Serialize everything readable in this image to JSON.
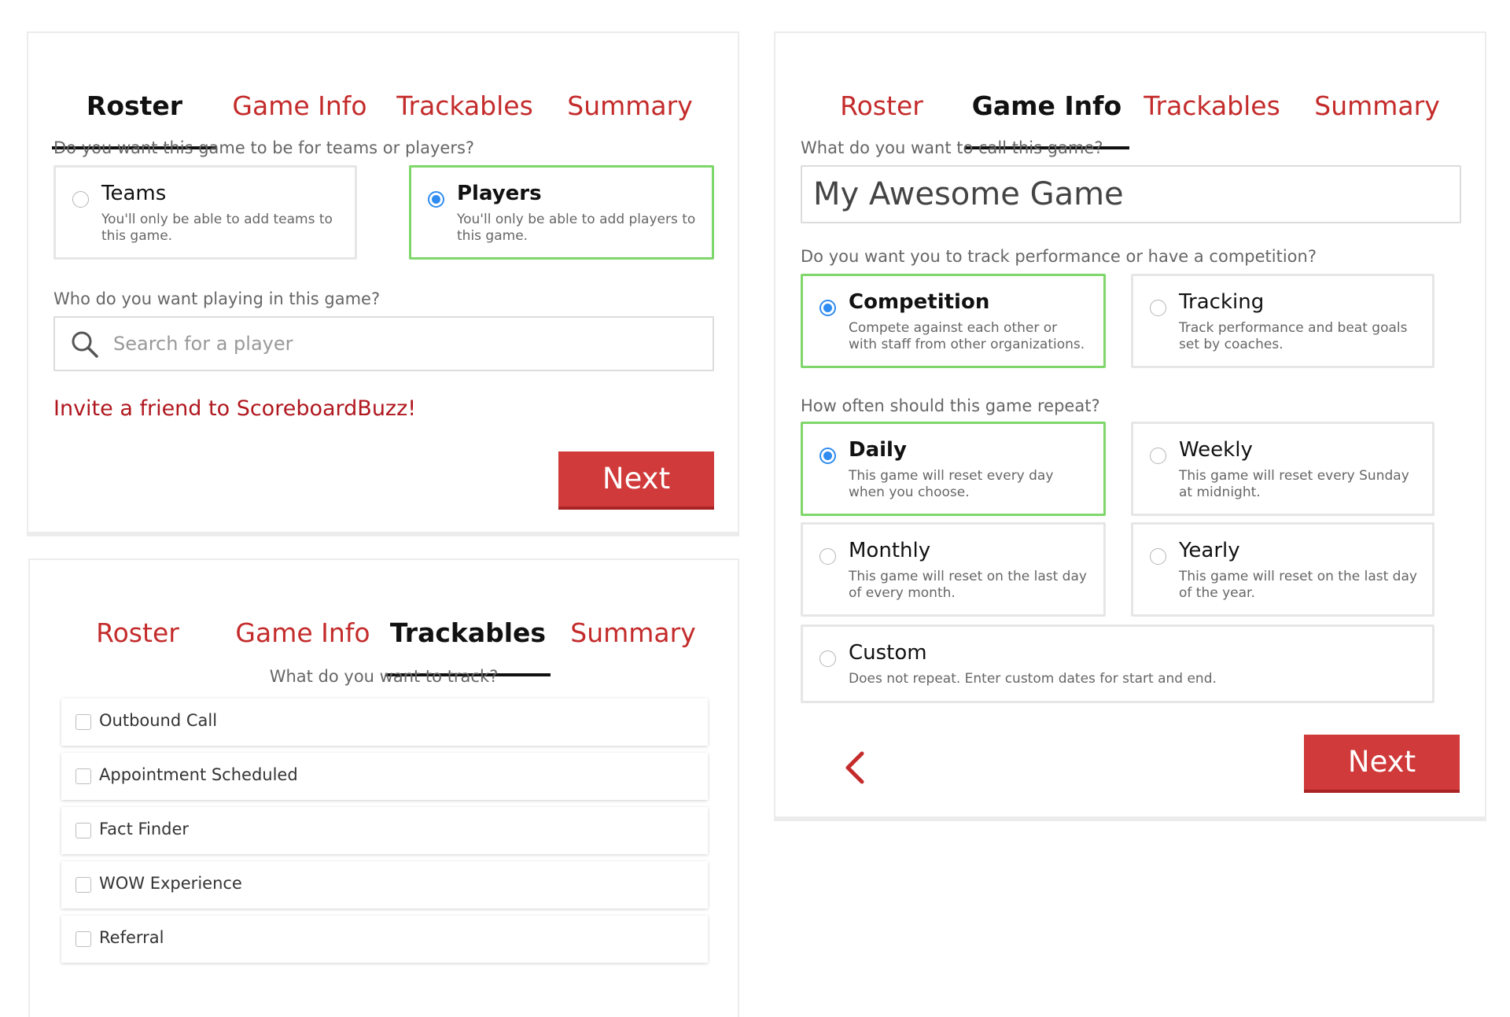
{
  "tabs": {
    "roster": "Roster",
    "game_info": "Game Info",
    "trackables": "Trackables",
    "summary": "Summary"
  },
  "roster": {
    "question_type": "Do you want this game to be for teams or players?",
    "options": [
      {
        "title": "Teams",
        "desc": "You'll only be able to add teams to this game.",
        "selected": false
      },
      {
        "title": "Players",
        "desc": "You'll only be able to add players to this game.",
        "selected": true
      }
    ],
    "question_players": "Who do you want playing in this game?",
    "search_placeholder": "Search for a player",
    "invite_link": "Invite a friend to ScoreboardBuzz!",
    "next_label": "Next"
  },
  "game_info": {
    "question_name": "What do you want to call this game?",
    "name_value": "My Awesome Game",
    "question_mode": "Do you want you to track performance or have a competition?",
    "mode_options": [
      {
        "title": "Competition",
        "desc": "Compete against each other or with staff from other organizations.",
        "selected": true
      },
      {
        "title": "Tracking",
        "desc": "Track performance and beat goals set by coaches.",
        "selected": false
      }
    ],
    "question_repeat": "How often should this game repeat?",
    "repeat_options": [
      {
        "title": "Daily",
        "desc": "This game will reset every day when you choose.",
        "selected": true
      },
      {
        "title": "Weekly",
        "desc": "This game will reset every Sunday at midnight.",
        "selected": false
      },
      {
        "title": "Monthly",
        "desc": "This game will reset on the last day of every month.",
        "selected": false
      },
      {
        "title": "Yearly",
        "desc": "This game will reset on the last day of the year.",
        "selected": false
      },
      {
        "title": "Custom",
        "desc": "Does not repeat. Enter custom dates for start and end.",
        "selected": false
      }
    ],
    "next_label": "Next"
  },
  "trackables": {
    "question": "What do you want to track?",
    "items": [
      {
        "label": "Outbound Call",
        "checked": false
      },
      {
        "label": "Appointment Scheduled",
        "checked": false
      },
      {
        "label": "Fact Finder",
        "checked": false
      },
      {
        "label": "WOW Experience",
        "checked": false
      },
      {
        "label": "Referral",
        "checked": false
      }
    ]
  },
  "colors": {
    "accent_red": "#c42b2b",
    "button_red": "#d03a3a",
    "selected_border": "#7fd66a",
    "radio_blue": "#2f8cf0"
  },
  "icons": {
    "search": "search-icon",
    "back": "chevron-left-icon"
  }
}
